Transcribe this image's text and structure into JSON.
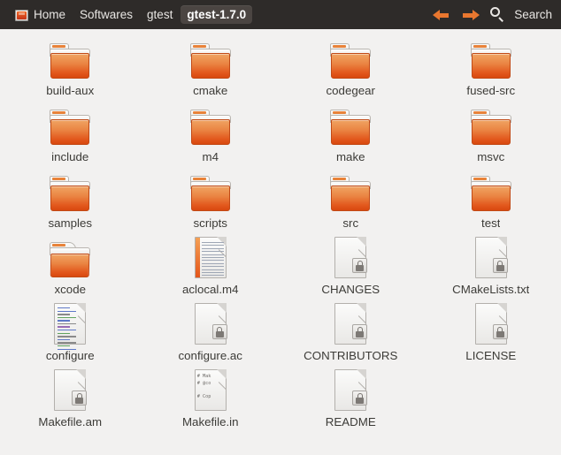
{
  "window": {
    "title": "gtest-1.7.0",
    "background_color": "#f2f1f0",
    "pathbar_color": "#2e2b29",
    "accent_color": "#e9772f"
  },
  "pathbar": {
    "home_icon": "home-folder-icon",
    "crumbs": [
      {
        "label": "Home",
        "icon": "home-folder-icon",
        "current": false
      },
      {
        "label": "Softwares",
        "icon": "",
        "current": false
      },
      {
        "label": "gtest",
        "icon": "",
        "current": false
      },
      {
        "label": "gtest-1.7.0",
        "icon": "",
        "current": true
      }
    ],
    "back_icon": "arrow-left-icon",
    "forward_icon": "arrow-right-icon",
    "search_icon": "search-icon",
    "search_label": "Search"
  },
  "files": [
    {
      "name": "build-aux",
      "type": "folder",
      "icon": "folder-icon"
    },
    {
      "name": "cmake",
      "type": "folder",
      "icon": "folder-icon"
    },
    {
      "name": "codegear",
      "type": "folder",
      "icon": "folder-icon"
    },
    {
      "name": "fused-src",
      "type": "folder",
      "icon": "folder-icon"
    },
    {
      "name": "include",
      "type": "folder",
      "icon": "folder-icon"
    },
    {
      "name": "m4",
      "type": "folder",
      "icon": "folder-icon"
    },
    {
      "name": "make",
      "type": "folder",
      "icon": "folder-icon"
    },
    {
      "name": "msvc",
      "type": "folder",
      "icon": "folder-icon"
    },
    {
      "name": "samples",
      "type": "folder",
      "icon": "folder-icon"
    },
    {
      "name": "scripts",
      "type": "folder",
      "icon": "folder-icon"
    },
    {
      "name": "src",
      "type": "folder",
      "icon": "folder-icon"
    },
    {
      "name": "test",
      "type": "folder",
      "icon": "folder-icon"
    },
    {
      "name": "xcode",
      "type": "folder-open",
      "icon": "folder-open-icon"
    },
    {
      "name": "aclocal.m4",
      "type": "text-doc",
      "icon": "text-document-icon"
    },
    {
      "name": "CHANGES",
      "type": "locked-doc",
      "icon": "locked-document-icon"
    },
    {
      "name": "CMakeLists.txt",
      "type": "locked-doc",
      "icon": "locked-document-icon"
    },
    {
      "name": "configure",
      "type": "script-doc",
      "icon": "script-document-icon"
    },
    {
      "name": "configure.ac",
      "type": "locked-doc",
      "icon": "locked-document-icon"
    },
    {
      "name": "CONTRIBUTORS",
      "type": "locked-doc",
      "icon": "locked-document-icon"
    },
    {
      "name": "LICENSE",
      "type": "locked-doc",
      "icon": "locked-document-icon"
    },
    {
      "name": "Makefile.am",
      "type": "locked-doc",
      "icon": "locked-document-icon"
    },
    {
      "name": "Makefile.in",
      "type": "preview-doc",
      "icon": "text-preview-document-icon",
      "preview_lines": [
        "# Mak",
        "# @co",
        "",
        "# Cop"
      ]
    },
    {
      "name": "README",
      "type": "locked-doc",
      "icon": "locked-document-icon"
    }
  ]
}
